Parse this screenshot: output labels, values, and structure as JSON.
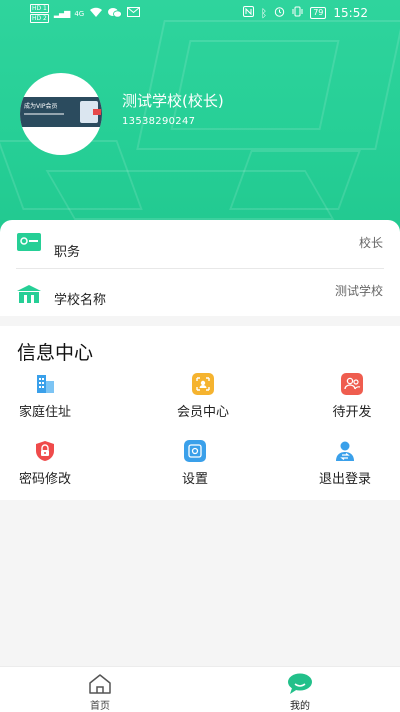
{
  "status_bar": {
    "sim1": "HD 1",
    "sim2": "HD 2",
    "net1": "4G",
    "net2": "4G",
    "battery": "79",
    "time": "15:52"
  },
  "profile": {
    "name": "测试学校(校长)",
    "phone": "13538290247",
    "avatar_banner_text": "成为VIP会员"
  },
  "info_rows": [
    {
      "label": "职务",
      "value": "校长",
      "icon": "id-card-icon"
    },
    {
      "label": "学校名称",
      "value": "测试学校",
      "icon": "school-building-icon"
    }
  ],
  "info_center": {
    "title": "信息中心",
    "items": [
      {
        "label": "家庭住址",
        "icon": "building-icon",
        "color": "#3aa0ea"
      },
      {
        "label": "会员中心",
        "icon": "member-card-icon",
        "color": "#f5b32f"
      },
      {
        "label": "待开发",
        "icon": "people-icon",
        "color": "#ef5d4f"
      },
      {
        "label": "密码修改",
        "icon": "lock-shield-icon",
        "color": "#ef4b4b"
      },
      {
        "label": "设置",
        "icon": "gear-icon",
        "color": "#3aa0ea"
      },
      {
        "label": "退出登录",
        "icon": "user-switch-icon",
        "color": "#3aa0ea"
      }
    ]
  },
  "tabbar": {
    "tabs": [
      {
        "label": "首页",
        "icon": "home-icon",
        "active": false
      },
      {
        "label": "我的",
        "icon": "chat-person-icon",
        "active": true
      }
    ]
  },
  "colors": {
    "accent": "#26cf96",
    "active_tab_icon": "#22c08a"
  }
}
